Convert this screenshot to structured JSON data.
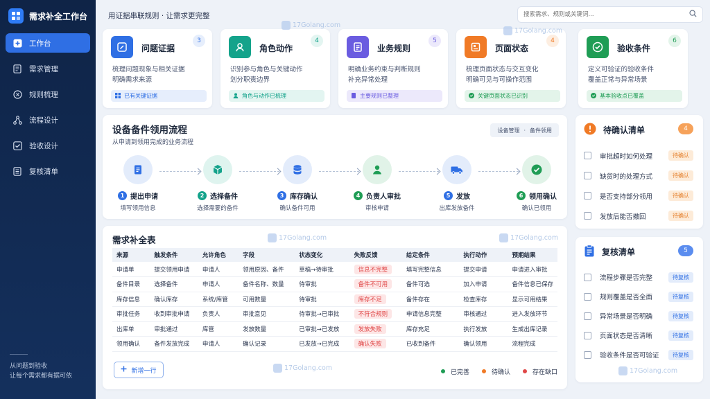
{
  "app": {
    "title": "需求补全工作台"
  },
  "sidebar": {
    "items": [
      {
        "label": "工作台",
        "icon": "plus-square-icon",
        "active": true
      },
      {
        "label": "需求管理",
        "icon": "document-icon"
      },
      {
        "label": "规则梳理",
        "icon": "rules-icon"
      },
      {
        "label": "流程设计",
        "icon": "flow-icon"
      },
      {
        "label": "验收设计",
        "icon": "check-square-icon"
      },
      {
        "label": "复核清单",
        "icon": "list-icon"
      }
    ],
    "footer_line1": "从问题到验收",
    "footer_line2": "让每个需求都有据可依"
  },
  "topbar": {
    "title": "用证据串联规则 · 让需求更完整",
    "search_placeholder": "搜索需求、规则或关键词..."
  },
  "cards": [
    {
      "title": "问题证据",
      "badge": "3",
      "desc1": "梳理问题现象与相关证据",
      "desc2": "明确需求来源",
      "tag": "已有关键证据",
      "color": "#2f6fe4",
      "soft": "#e6eefc"
    },
    {
      "title": "角色动作",
      "badge": "4",
      "desc1": "识别参与角色与关键动作",
      "desc2": "划分职责边界",
      "tag": "角色与动作已梳理",
      "color": "#14a38b",
      "soft": "#e3f5f1"
    },
    {
      "title": "业务规则",
      "badge": "5",
      "desc1": "明确业务约束与判断规则",
      "desc2": "补充异常处理",
      "tag": "主要规则已整理",
      "color": "#6a5ce0",
      "soft": "#ece9fb"
    },
    {
      "title": "页面状态",
      "badge": "4",
      "desc1": "梳理页面状态与交互变化",
      "desc2": "明确可见与可操作范围",
      "tag": "关键页面状态已识别",
      "color": "#f07a26",
      "soft": "#fdeee1"
    },
    {
      "title": "验收条件",
      "badge": "6",
      "desc1": "定义可验证的验收条件",
      "desc2": "覆盖正常与异常场景",
      "tag": "基本验收点已覆盖",
      "color": "#1f9d55",
      "soft": "#e3f4ea"
    }
  ],
  "flow": {
    "title": "设备备件领用流程",
    "subtitle": "从申请到领用完成的业务流程",
    "tag_a": "设备管理",
    "tag_sep": "·",
    "tag_b": "备件领用",
    "steps": [
      {
        "num": "1",
        "label": "提出申请",
        "desc": "填写领用信息",
        "icon": "document-icon",
        "color": "#2f6fe4",
        "soft": "#e3ecfb"
      },
      {
        "num": "2",
        "label": "选择备件",
        "desc": "选择需要的备件",
        "icon": "box-icon",
        "color": "#14a38b",
        "soft": "#dff4ef"
      },
      {
        "num": "3",
        "label": "库存确认",
        "desc": "确认备件可用",
        "icon": "database-icon",
        "color": "#2f6fe4",
        "soft": "#e3ecfb"
      },
      {
        "num": "4",
        "label": "负责人审批",
        "desc": "审核申请",
        "icon": "user-icon",
        "color": "#1f9d55",
        "soft": "#e1f3e8"
      },
      {
        "num": "5",
        "label": "发放",
        "desc": "出库发放备件",
        "icon": "truck-icon",
        "color": "#2f6fe4",
        "soft": "#e3ecfb"
      },
      {
        "num": "6",
        "label": "领用确认",
        "desc": "确认已领用",
        "icon": "check-circle-icon",
        "color": "#1f9d55",
        "soft": "#e1f3e8"
      }
    ]
  },
  "table": {
    "title": "需求补全表",
    "headers": [
      "来源",
      "触发条件",
      "允许角色",
      "字段",
      "状态变化",
      "失败反馈",
      "给定条件",
      "执行动作",
      "预期结果"
    ],
    "rows": [
      [
        "申请单",
        "提交领用申请",
        "申请人",
        "领用原因、备件",
        "草稿→待审批",
        "信息不完整",
        "填写完整信息",
        "提交申请",
        "申请进入审批"
      ],
      [
        "备件目录",
        "选择备件",
        "申请人",
        "备件名称、数量",
        "待审批",
        "备件不可用",
        "备件可选",
        "加入申请",
        "备件信息已保存"
      ],
      [
        "库存信息",
        "确认库存",
        "系统/库管",
        "可用数量",
        "待审批",
        "库存不足",
        "备件存在",
        "检查库存",
        "显示可用结果"
      ],
      [
        "审批任务",
        "收到审批申请",
        "负责人",
        "审批意见",
        "待审批→已审批",
        "不符合规则",
        "申请信息完整",
        "审核通过",
        "进入发放环节"
      ],
      [
        "出库单",
        "审批通过",
        "库管",
        "发放数量",
        "已审批→已发放",
        "发放失败",
        "库存充足",
        "执行发放",
        "生成出库记录"
      ],
      [
        "领用确认",
        "备件发放完成",
        "申请人",
        "确认记录",
        "已发放→已完成",
        "确认失败",
        "已收到备件",
        "确认领用",
        "流程完成"
      ]
    ],
    "add_label": "新增一行",
    "legend": [
      {
        "label": "已完善",
        "color": "#1f9d55"
      },
      {
        "label": "待确认",
        "color": "#f07a26"
      },
      {
        "label": "存在缺口",
        "color": "#e04747"
      }
    ]
  },
  "confirm": {
    "title": "待确认清单",
    "count": "4",
    "items": [
      {
        "text": "审批超时如何处理",
        "status": "待确认"
      },
      {
        "text": "缺货时的处理方式",
        "status": "待确认"
      },
      {
        "text": "是否支持部分领用",
        "status": "待确认"
      },
      {
        "text": "发放后能否撤回",
        "status": "待确认"
      }
    ]
  },
  "review": {
    "title": "复核清单",
    "count": "5",
    "items": [
      {
        "text": "流程步骤是否完整",
        "status": "待复核"
      },
      {
        "text": "规则覆盖是否全面",
        "status": "待复核"
      },
      {
        "text": "异常场景是否明确",
        "status": "待复核"
      },
      {
        "text": "页面状态是否清晰",
        "status": "待复核"
      },
      {
        "text": "验收条件是否可验证",
        "status": "待复核"
      }
    ]
  },
  "watermark": {
    "text": "17Golang.com"
  }
}
